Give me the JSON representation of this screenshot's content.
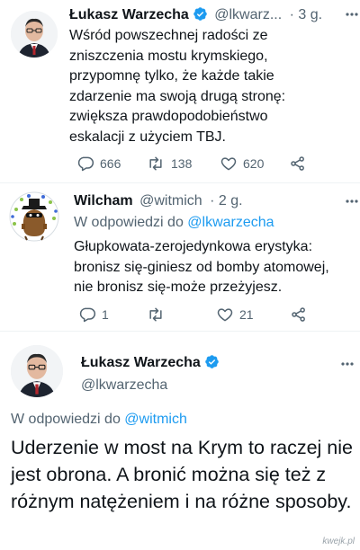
{
  "tweet1": {
    "author_name": "Łukasz Warzecha",
    "handle": "@lkwarz...",
    "time": "· 3 g.",
    "text": "Wśród powszechnej radości ze zniszczenia mostu krymskiego, przypomnę tylko, że każde takie zdarzenie ma swoją drugą stronę: zwiększa prawdopodobieństwo eskalacji z użyciem TBJ.",
    "replies": "666",
    "retweets": "138",
    "likes": "620"
  },
  "tweet2": {
    "author_name": "Wilcham",
    "handle": "@witmich",
    "time": "· 2 g.",
    "reply_prefix": "W odpowiedzi do",
    "reply_mention": "@lkwarzecha",
    "text": "Głupkowata-zerojedynkowa erystyka: bronisz się-giniesz od bomby atomowej, nie bronisz się-może przeżyjesz.",
    "replies": "1",
    "retweets": "",
    "likes": "21"
  },
  "tweet3": {
    "author_name": "Łukasz Warzecha",
    "handle": "@lkwarzecha",
    "reply_prefix": "W odpowiedzi do",
    "reply_mention": "@witmich",
    "text": "Uderzenie w most na Krym to raczej nie jest obrona. A bronić można się też z różnym natężeniem i na różne sposoby."
  },
  "watermark": "kwejk.pl",
  "colors": {
    "accent": "#1d9bf0",
    "secondary_text": "#536471",
    "primary_text": "#0f1419",
    "verified": "#1d9bf0"
  },
  "icons": [
    "reply-icon",
    "retweet-icon",
    "like-icon",
    "share-icon",
    "verified-badge-icon",
    "more-options-icon"
  ]
}
